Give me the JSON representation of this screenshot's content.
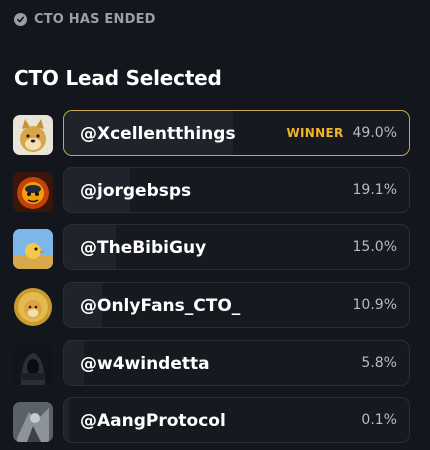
{
  "status": {
    "label": "CTO HAS ENDED",
    "icon": "check-circle-icon"
  },
  "title": "CTO Lead Selected",
  "winner_label": "WINNER",
  "colors": {
    "winner_border": "#c9a84a",
    "winner_text": "#f0b429",
    "background": "#14161d"
  },
  "candidates": [
    {
      "handle": "@Xcellentthings",
      "percent": "49.0%",
      "share": 0.49,
      "winner": true,
      "avatar": "doge-avatar"
    },
    {
      "handle": "@jorgebsps",
      "percent": "19.1%",
      "share": 0.191,
      "winner": false,
      "avatar": "fire-character-avatar"
    },
    {
      "handle": "@TheBibiGuy",
      "percent": "15.0%",
      "share": 0.15,
      "winner": false,
      "avatar": "bird-field-avatar"
    },
    {
      "handle": "@OnlyFans_CTO_",
      "percent": "10.9%",
      "share": 0.109,
      "winner": false,
      "avatar": "doge-coin-avatar"
    },
    {
      "handle": "@w4windetta",
      "percent": "5.8%",
      "share": 0.058,
      "winner": false,
      "avatar": "hooded-win-avatar"
    },
    {
      "handle": "@AangProtocol",
      "percent": "0.1%",
      "share": 0.001,
      "winner": false,
      "avatar": "grey-figure-avatar"
    }
  ]
}
